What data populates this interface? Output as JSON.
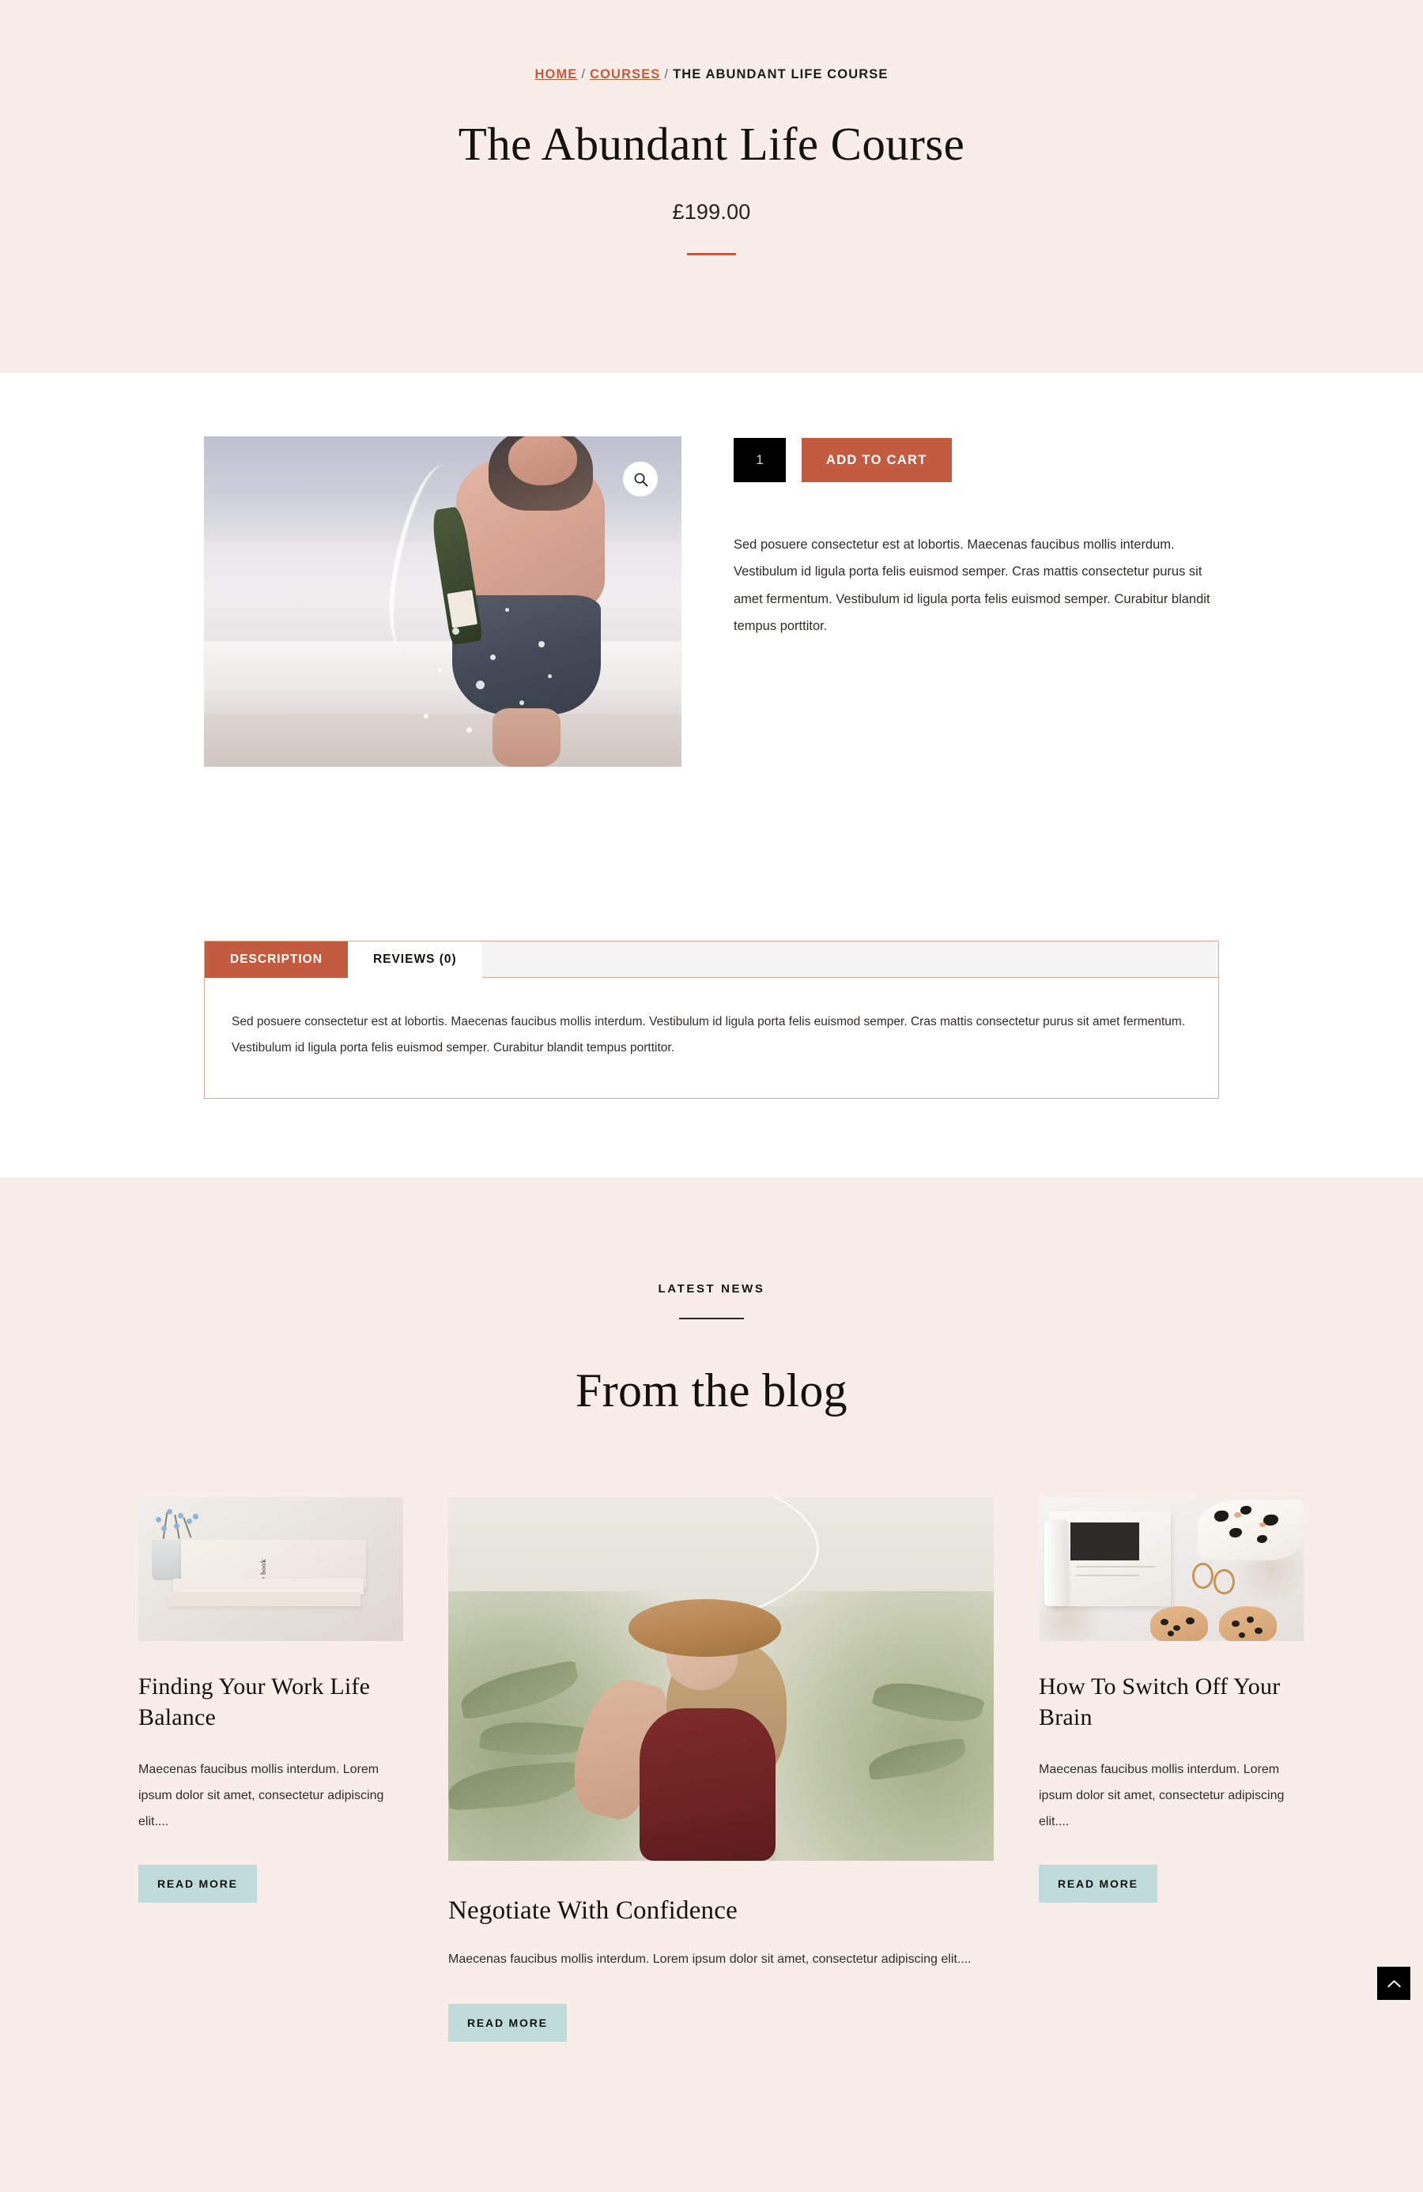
{
  "breadcrumb": {
    "home": "HOME",
    "sep": "/",
    "courses": "COURSES",
    "current": "THE ABUNDANT LIFE COURSE"
  },
  "product": {
    "title": "The Abundant Life Course",
    "price": "£199.00",
    "quantity": "1",
    "quantity_placeholder": "1",
    "add_to_cart_label": "ADD TO CART",
    "short_description": "Sed posuere consectetur est at lobortis. Maecenas faucibus mollis interdum. Vestibulum id ligula porta felis euismod semper. Cras mattis consectetur purus sit amet fermentum. Vestibulum id ligula porta felis euismod semper. Curabitur blandit tempus porttitor.",
    "image_alt": "woman-spraying-champagne-on-beach",
    "zoom_icon": "search-icon"
  },
  "tabs": {
    "items": [
      {
        "label": "DESCRIPTION",
        "active": true
      },
      {
        "label": "REVIEWS (0)",
        "active": false
      }
    ],
    "panel_text": "Sed posuere consectetur est at lobortis. Maecenas faucibus mollis interdum. Vestibulum id ligula porta felis euismod semper. Cras mattis consectetur purus sit amet fermentum. Vestibulum id ligula porta felis euismod semper. Curabitur blandit tempus porttitor."
  },
  "blog": {
    "eyebrow": "LATEST NEWS",
    "heading": "From the blog",
    "posts": [
      {
        "title": "Finding Your Work Life Balance",
        "excerpt": "Maecenas faucibus mollis interdum. Lorem ipsum dolor sit amet, consectetur adipiscing elit....",
        "read_more": "READ MORE",
        "image_alt": "stack-of-books-with-blue-flowers"
      },
      {
        "title": "Negotiate With Confidence",
        "excerpt": "Maecenas faucibus mollis interdum. Lorem ipsum dolor sit amet, consectetur adipiscing elit....",
        "read_more": "READ MORE",
        "image_alt": "woman-in-straw-hat-in-greenhouse"
      },
      {
        "title": "How To Switch Off Your Brain",
        "excerpt": "Maecenas faucibus mollis interdum. Lorem ipsum dolor sit amet, consectetur adipiscing elit....",
        "read_more": "READ MORE",
        "image_alt": "flatlay-magazine-earrings-leopard-slides"
      }
    ]
  },
  "scroll_top": {
    "icon": "chevron-up-icon",
    "label": ""
  },
  "colors": {
    "accent": "#C25B3F",
    "hero_background": "#F8EDE8",
    "blog_background": "#F8EDE8",
    "read_more_background": "#BFDCDB",
    "quantity_background": "#000000",
    "tab_inactive_background": "#F4F4F4",
    "text": "#14110F"
  },
  "book_cover_text": "the type book"
}
